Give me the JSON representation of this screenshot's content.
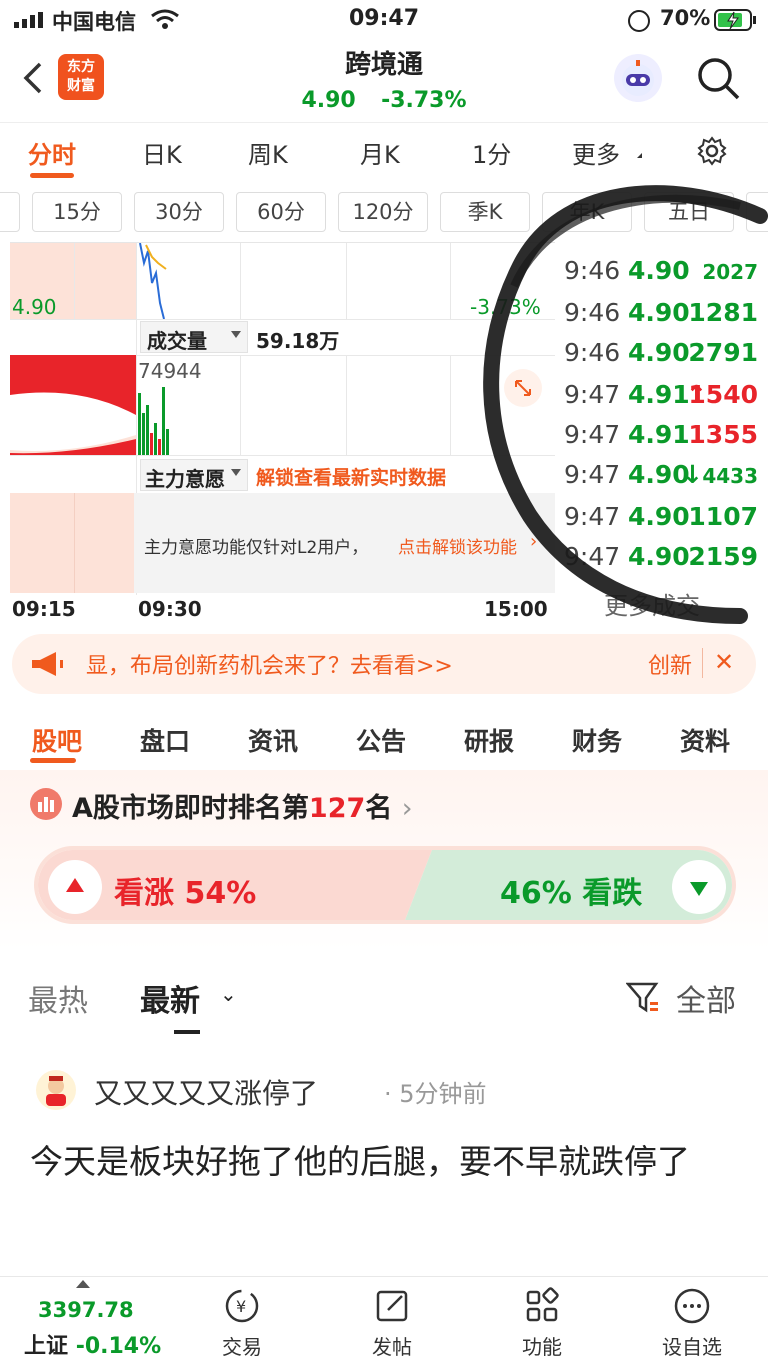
{
  "status": {
    "carrier": "中国电信",
    "time": "09:47",
    "battery": "70%"
  },
  "header": {
    "logo_line1": "东方",
    "logo_line2": "财富",
    "stock_name": "跨境通",
    "price": "4.90",
    "change": "-3.73%"
  },
  "ktabs": [
    "分时",
    "日K",
    "周K",
    "月K",
    "1分",
    "更多"
  ],
  "periods": [
    "15分",
    "30分",
    "60分",
    "120分",
    "季K",
    "年K",
    "五日"
  ],
  "chart": {
    "price_label": "4.90",
    "pct_label": "-3.73%",
    "volume_label": "成交量",
    "volume_value": "59.18万",
    "volume_num": "74944",
    "main_force_label": "主力意愿",
    "unlock_text": "解锁查看最新实时数据",
    "l2_notice": "主力意愿功能仅针对L2用户，",
    "l2_link": "点击解锁该功能",
    "time_start": "09:15",
    "time_mid": "09:30",
    "time_end": "15:00"
  },
  "trades": [
    {
      "time": "9:46",
      "price": "4.90",
      "vol": "2027",
      "vol_color": "green",
      "arrow": ""
    },
    {
      "time": "9:46",
      "price": "4.90",
      "vol": "1281",
      "vol_color": "green",
      "arrow": ""
    },
    {
      "time": "9:46",
      "price": "4.90",
      "vol": "2791",
      "vol_color": "green",
      "arrow": ""
    },
    {
      "time": "9:47",
      "price": "4.91",
      "vol": "1540",
      "vol_color": "red",
      "arrow": "↑"
    },
    {
      "time": "9:47",
      "price": "4.91",
      "vol": "1355",
      "vol_color": "red",
      "arrow": ""
    },
    {
      "time": "9:47",
      "price": "4.90",
      "vol": "4433",
      "vol_color": "green",
      "arrow": "↓"
    },
    {
      "time": "9:47",
      "price": "4.90",
      "vol": "1107",
      "vol_color": "green",
      "arrow": ""
    },
    {
      "time": "9:47",
      "price": "4.90",
      "vol": "2159",
      "vol_color": "green",
      "arrow": ""
    }
  ],
  "trades_more": "更多成交",
  "banner": {
    "text": "显，布局创新药机会来了？去看看>>",
    "tag": "创新"
  },
  "section_tabs": [
    "股吧",
    "盘口",
    "资讯",
    "公告",
    "研报",
    "财务",
    "资料"
  ],
  "rank": {
    "prefix": "A股市场即时排名第",
    "num": "127",
    "suffix": "名"
  },
  "vote": {
    "up_label": "看涨",
    "up_pct": "54%",
    "down_pct": "46%",
    "down_label": "看跌",
    "up_share": 0.54
  },
  "sort": {
    "hot": "最热",
    "new": "最新",
    "filter": "全部"
  },
  "post": {
    "author": "又又又又又涨停了",
    "time": "5分钟前",
    "body": "今天是板块好拖了他的后腿，要不早就跌停了"
  },
  "bottom": {
    "index_value": "3397.78",
    "index_name": "上证",
    "index_change": "-0.14%",
    "trade": "交易",
    "post": "发帖",
    "function": "功能",
    "watch": "设自选"
  }
}
